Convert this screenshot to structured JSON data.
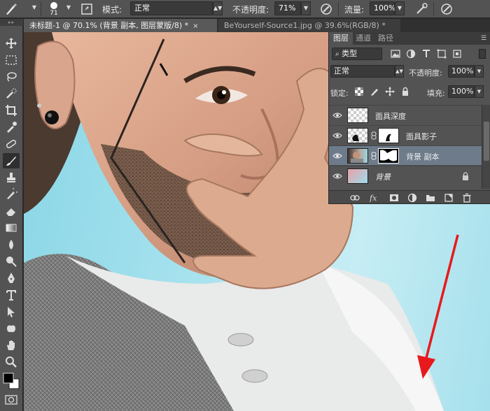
{
  "options_bar": {
    "brush_size": "71",
    "mode_label": "模式:",
    "mode_value": "正常",
    "opacity_label": "不透明度:",
    "opacity_value": "71%",
    "flow_label": "流量:",
    "flow_value": "100%"
  },
  "document_tabs": [
    {
      "label": "未标题-1 @ 70.1% (背景 副本, 图层蒙版/8) *",
      "close": "×",
      "active": true
    },
    {
      "label": "BeYourself-Source1.jpg @ 39.6%(RGB/8) *",
      "active": false
    }
  ],
  "layers_panel": {
    "tabs": [
      {
        "label": "图层",
        "active": true
      },
      {
        "label": "通道",
        "active": false
      },
      {
        "label": "路径",
        "active": false
      }
    ],
    "filter_kind": "类型",
    "blend_mode": "正常",
    "opacity_label": "不透明度:",
    "opacity_value": "100%",
    "lock_label": "锁定:",
    "fill_label": "填充:",
    "fill_value": "100%",
    "layers": [
      {
        "name": "面具深度",
        "selected": false,
        "has_mask": false,
        "locked": false,
        "italic": false
      },
      {
        "name": "面具影子",
        "selected": false,
        "has_mask": true,
        "locked": false,
        "italic": false
      },
      {
        "name": "背景 副本",
        "selected": true,
        "has_mask": true,
        "locked": false,
        "italic": false
      },
      {
        "name": "背景",
        "selected": false,
        "has_mask": false,
        "locked": true,
        "italic": true
      }
    ]
  },
  "colors": {
    "ui_panel": "#535353",
    "ui_dark": "#282828",
    "selected_layer": "#6d7b8a",
    "canvas_sky": "#a7e2ee",
    "annotation_arrow": "#e8191c",
    "foreground_color": "#000000",
    "background_color": "#ffffff"
  },
  "icons": {
    "toolbar": [
      "move-icon",
      "marquee-icon",
      "lasso-icon",
      "quick-select-icon",
      "crop-icon",
      "eyedropper-icon",
      "healing-icon",
      "brush-icon",
      "clone-stamp-icon",
      "history-brush-icon",
      "eraser-icon",
      "gradient-icon",
      "blur-icon",
      "dodge-icon",
      "pen-icon",
      "type-icon",
      "path-select-icon",
      "shape-icon",
      "hand-icon",
      "zoom-icon"
    ],
    "layer_footer": [
      "link-icon",
      "fx-icon",
      "add-mask-icon",
      "adjustment-icon",
      "group-icon",
      "new-layer-icon",
      "trash-icon"
    ]
  }
}
